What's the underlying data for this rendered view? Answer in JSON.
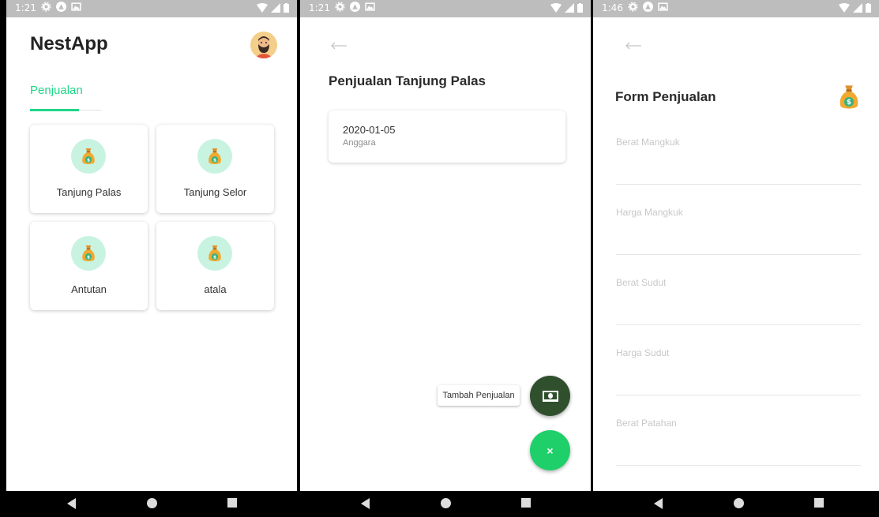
{
  "colors": {
    "accent": "#1ed787",
    "fab_dark": "#2f4f2d",
    "fab_green": "#1fd06a",
    "icon_bg": "#c9f3e1"
  },
  "nav_icons": [
    "back-triangle-icon",
    "home-circle-icon",
    "recent-square-icon"
  ],
  "panel1": {
    "status_time": "1:21",
    "app_title": "NestApp",
    "tab_label": "Penjualan",
    "cards": [
      "Tanjung Palas",
      "Tanjung Selor",
      "Antutan",
      "atala"
    ]
  },
  "panel2": {
    "status_time": "1:21",
    "page_title": "Penjualan Tanjung Palas",
    "entry": {
      "date": "2020-01-05",
      "name": "Anggara"
    },
    "tooltip": "Tambah Penjualan",
    "fab_close": "×"
  },
  "panel3": {
    "status_time": "1:46",
    "form_title": "Form Penjualan",
    "fields": [
      "Berat Mangkuk",
      "Harga Mangkuk",
      "Berat Sudut",
      "Harga Sudut",
      "Berat Patahan"
    ]
  }
}
